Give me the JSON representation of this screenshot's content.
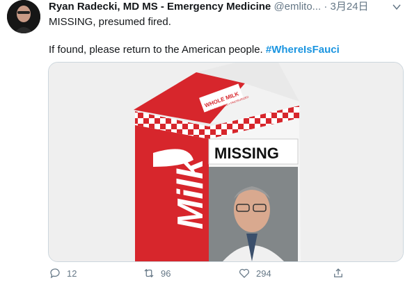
{
  "tweet": {
    "author_name": "Ryan Radecki, MD MS - Emergency Medicine",
    "author_handle": "@emlito...",
    "separator": "·",
    "date": "3月24日",
    "line1": "MISSING, presumed fired.",
    "line2": "If found, please return to the American people.",
    "hashtag": "#WhereIsFauci"
  },
  "media": {
    "carton_top_label": "WHOLE MILK",
    "carton_sub_label": "HOMOGENIZED • PASTEURIZED",
    "missing_label": "MISSING",
    "brand_text": "Milk"
  },
  "actions": {
    "reply_count": "12",
    "retweet_count": "96",
    "like_count": "294"
  },
  "colors": {
    "link": "#1b95e0",
    "muted": "#657786",
    "carton_red": "#d7262c"
  }
}
